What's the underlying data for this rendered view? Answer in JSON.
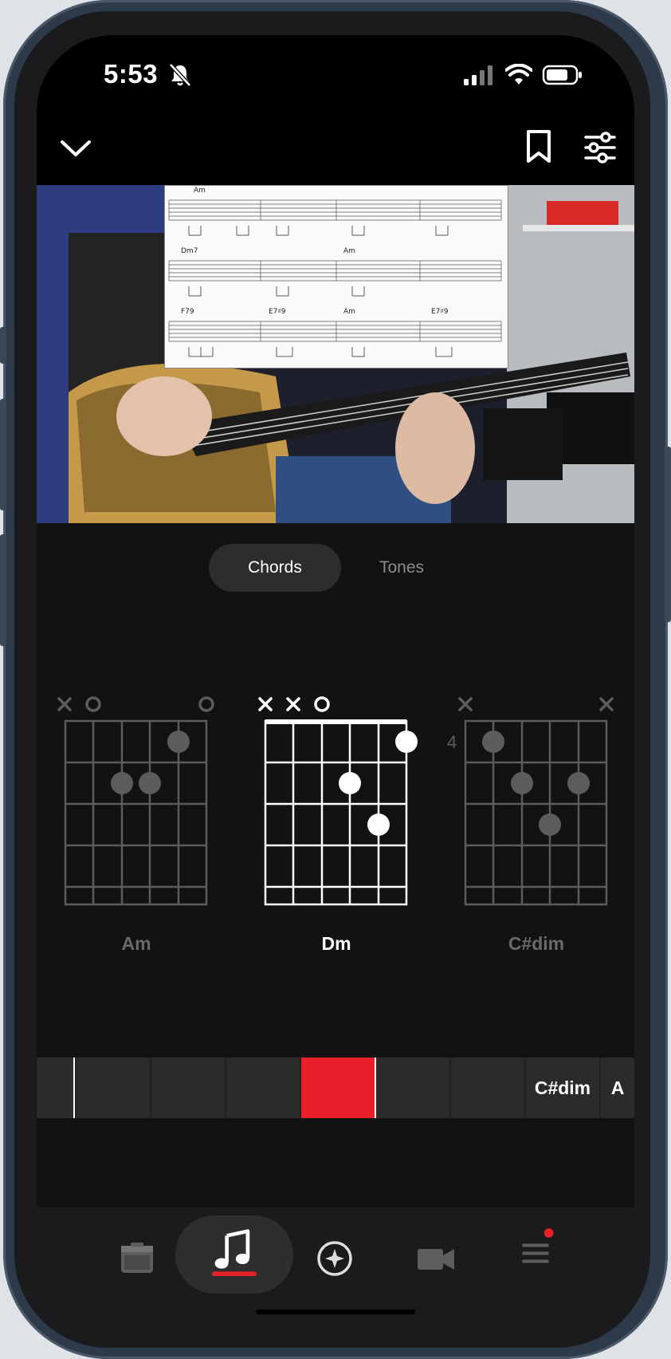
{
  "status": {
    "time": "5:53"
  },
  "segment": {
    "chords_label": "Chords",
    "tones_label": "Tones",
    "selected": "Chords"
  },
  "sheet": {
    "row1": [
      "Am"
    ],
    "row2": [
      "Dm7",
      "Am"
    ],
    "row3": [
      "F79",
      "E7♯9",
      "Am",
      "E7♯9"
    ]
  },
  "chords": [
    {
      "name": "Am",
      "fret_label": ""
    },
    {
      "name": "Dm",
      "fret_label": ""
    },
    {
      "name": "C#dim",
      "fret_label": "4"
    }
  ],
  "timeline": {
    "labels": [
      "C#dim",
      "A"
    ],
    "progress_marker": "red"
  },
  "nav": {
    "items": [
      "amp-icon",
      "music-note-icon",
      "compass-icon",
      "video-camera-icon",
      "menu-icon"
    ],
    "active": "music-note-icon"
  },
  "colors": {
    "accent": "#e8202a",
    "bg": "#121212"
  }
}
